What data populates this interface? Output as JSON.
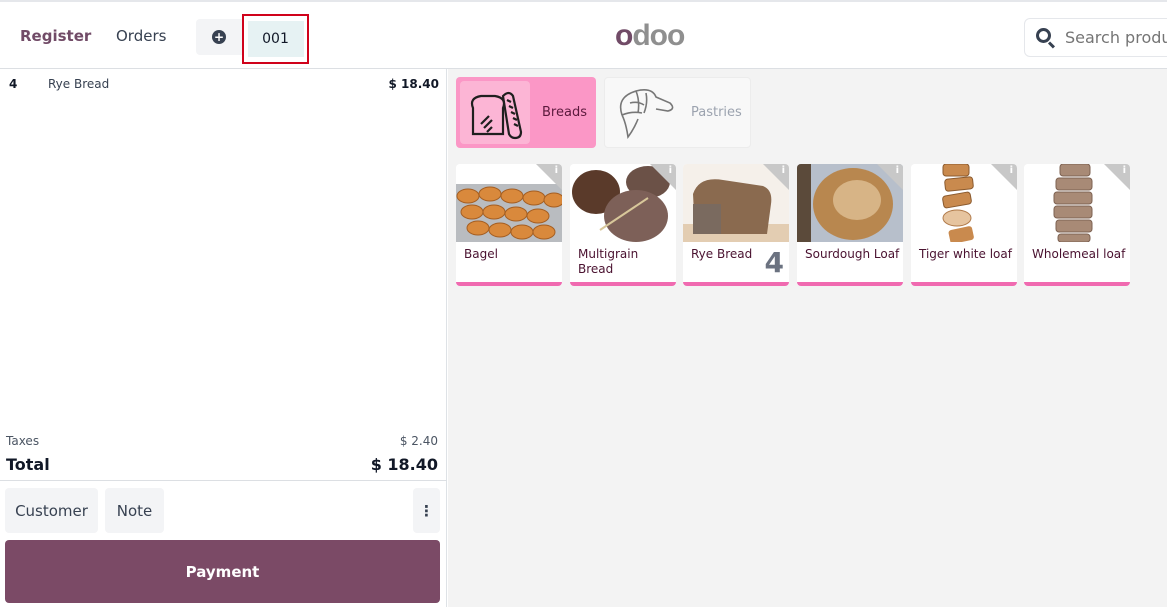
{
  "header": {
    "nav": {
      "register": "Register",
      "orders": "Orders"
    },
    "add_order_icon": "plus-circle-icon",
    "current_order": "001",
    "logo_first": "o",
    "logo_rest": "doo",
    "search": {
      "placeholder": "Search products...",
      "icon": "search-icon"
    }
  },
  "order": {
    "lines": [
      {
        "qty": "4",
        "name": "Rye Bread",
        "price": "$ 18.40"
      }
    ],
    "taxes_label": "Taxes",
    "taxes_value": "$ 2.40",
    "total_label": "Total",
    "total_value": "$ 18.40",
    "buttons": {
      "customer": "Customer",
      "note": "Note",
      "more": "⋮",
      "payment": "Payment"
    }
  },
  "categories": [
    {
      "label": "Breads",
      "icon": "bread-icon",
      "active": true
    },
    {
      "label": "Pastries",
      "icon": "croissant-icon",
      "active": false
    }
  ],
  "products": [
    {
      "name": "Bagel",
      "qty": ""
    },
    {
      "name": "Multigrain Bread",
      "qty": ""
    },
    {
      "name": "Rye Bread",
      "qty": "4"
    },
    {
      "name": "Sourdough Loaf",
      "qty": ""
    },
    {
      "name": "Tiger white loaf",
      "qty": ""
    },
    {
      "name": "Wholemeal loaf",
      "qty": ""
    }
  ],
  "colors": {
    "brand": "#714b67",
    "payment": "#7b4a66",
    "category_active": "#fb97c6",
    "product_accent": "#f06ab0",
    "selected_order_outline": "#d0021b"
  }
}
